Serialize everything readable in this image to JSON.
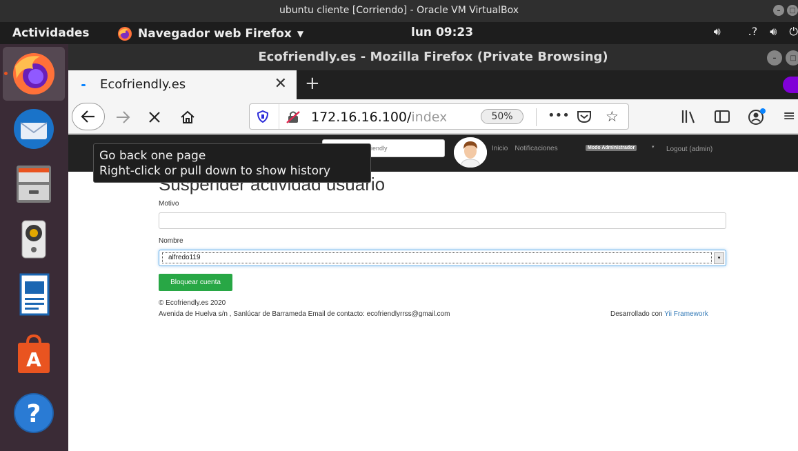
{
  "virtualbox": {
    "title": "ubuntu cliente [Corriendo] - Oracle VM VirtualBox"
  },
  "topbar": {
    "activities": "Actividades",
    "app_menu": "Navegador web Firefox",
    "clock": "lun 09:23",
    "tray_icons": [
      "speaker-icon",
      "network-question-icon",
      "volume-icon",
      "power-icon"
    ]
  },
  "dock": {
    "apps": [
      {
        "name": "firefox",
        "icon": "firefox-icon",
        "active": true
      },
      {
        "name": "thunderbird",
        "icon": "thunderbird-mail-icon",
        "active": false
      },
      {
        "name": "files",
        "icon": "file-cabinet-icon",
        "active": false
      },
      {
        "name": "rhythmbox",
        "icon": "speaker-music-icon",
        "active": false
      },
      {
        "name": "writer",
        "icon": "writer-document-icon",
        "active": false
      },
      {
        "name": "software",
        "icon": "software-store-icon",
        "active": false
      },
      {
        "name": "help",
        "icon": "help-icon",
        "active": false
      }
    ]
  },
  "firefox": {
    "window_title": "Ecofriendly.es - Mozilla Firefox (Private Browsing)",
    "tab_label": "Ecofriendly.es",
    "url_main": "172.16.16.100/",
    "url_dim": "index",
    "zoom": "50%",
    "tooltip_line1": "Go back one page",
    "tooltip_line2": "Right-click or pull down to show history"
  },
  "site": {
    "search_placeholder": "Buscar en Ecofriendly",
    "nav_links": [
      "Inicio",
      "Notificaciones"
    ],
    "admin_badge": "Modo Administrador",
    "logout": "Logout (admin)",
    "page_title": "Suspender actividad usuario",
    "motivo_label": "Motivo",
    "motivo_value": "",
    "nombre_label": "Nombre",
    "nombre_value": "alfredo119",
    "submit_button": "Bloquear cuenta",
    "footer_copyright": "© Ecofriendly.es 2020",
    "footer_address": "Avenida de Huelva s/n , Sanlúcar de Barrameda Email de contacto: ecofriendlyrrss@gmail.com",
    "footer_dev_prefix": "Desarrollado con",
    "footer_dev_link": "Yii Framework"
  },
  "colors": {
    "ubuntu_orange": "#e95420",
    "button_green": "#28a745",
    "link_blue": "#337ab7"
  }
}
